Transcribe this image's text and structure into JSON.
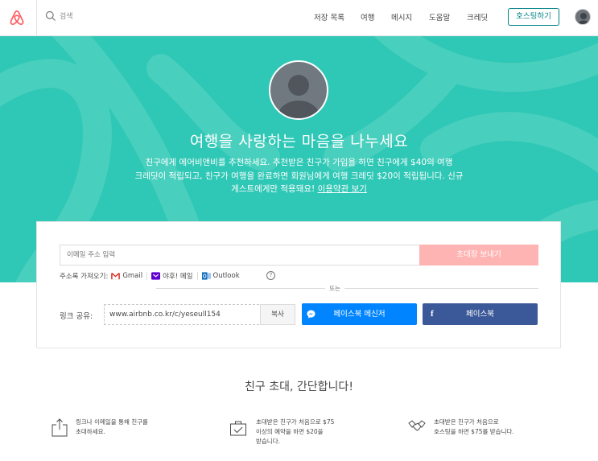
{
  "header": {
    "search_placeholder": "검색",
    "nav": [
      "저장 목록",
      "여행",
      "메시지",
      "도움말",
      "크레딧"
    ],
    "host_button": "호스팅하기"
  },
  "hero": {
    "title": "여행을 사랑하는 마음을 나누세요",
    "desc_line1": "친구에게 에어비앤비를 추천하세요. 추천받은 친구가 가입을 하면 친구에게 $40의 여행",
    "desc_line2": "크레딧이 적립되고, 친구가 여행을 완료하면 회원님에게 여행 크레딧 $20이 적립됩니다. 신규",
    "desc_line3": "게스트에게만 적용돼요!",
    "terms_link": "이용약관 보기"
  },
  "invite": {
    "email_placeholder": "이메일 주소 입력",
    "send_button": "초대장 보내기",
    "import_label": "주소록 가져오기:",
    "sources": [
      "Gmail",
      "야후! 메일",
      "Outlook"
    ],
    "help_glyph": "?",
    "or_text": "또는",
    "share_label": "링크 공유:",
    "share_link": "www.airbnb.co.kr/c/yeseull154",
    "copy_button": "복사",
    "messenger_button": "페이스북 메신저",
    "facebook_button": "페이스북"
  },
  "steps": {
    "title": "친구 초대, 간단합니다!",
    "items": [
      {
        "icon": "share-icon",
        "line1": "링크나 이메일을 통해 친구를",
        "line2": "초대하세요.",
        "line3": ""
      },
      {
        "icon": "suitcase-icon",
        "line1": "초대받은 친구가 처음으로 $75",
        "line2": "이상의 예약을 하면 $20을",
        "line3": "받습니다."
      },
      {
        "icon": "handshake-icon",
        "line1": "초대받은 친구가 처음으로",
        "line2": "호스팅을 하면 $75를 받습니다.",
        "line3": ""
      }
    ]
  },
  "colors": {
    "brand": "#FF5A5F",
    "hero_bg": "#2FC7B5",
    "host_border": "#008489",
    "invite_button": "#FFB4B4",
    "messenger": "#0084FF",
    "facebook": "#3B5998"
  }
}
